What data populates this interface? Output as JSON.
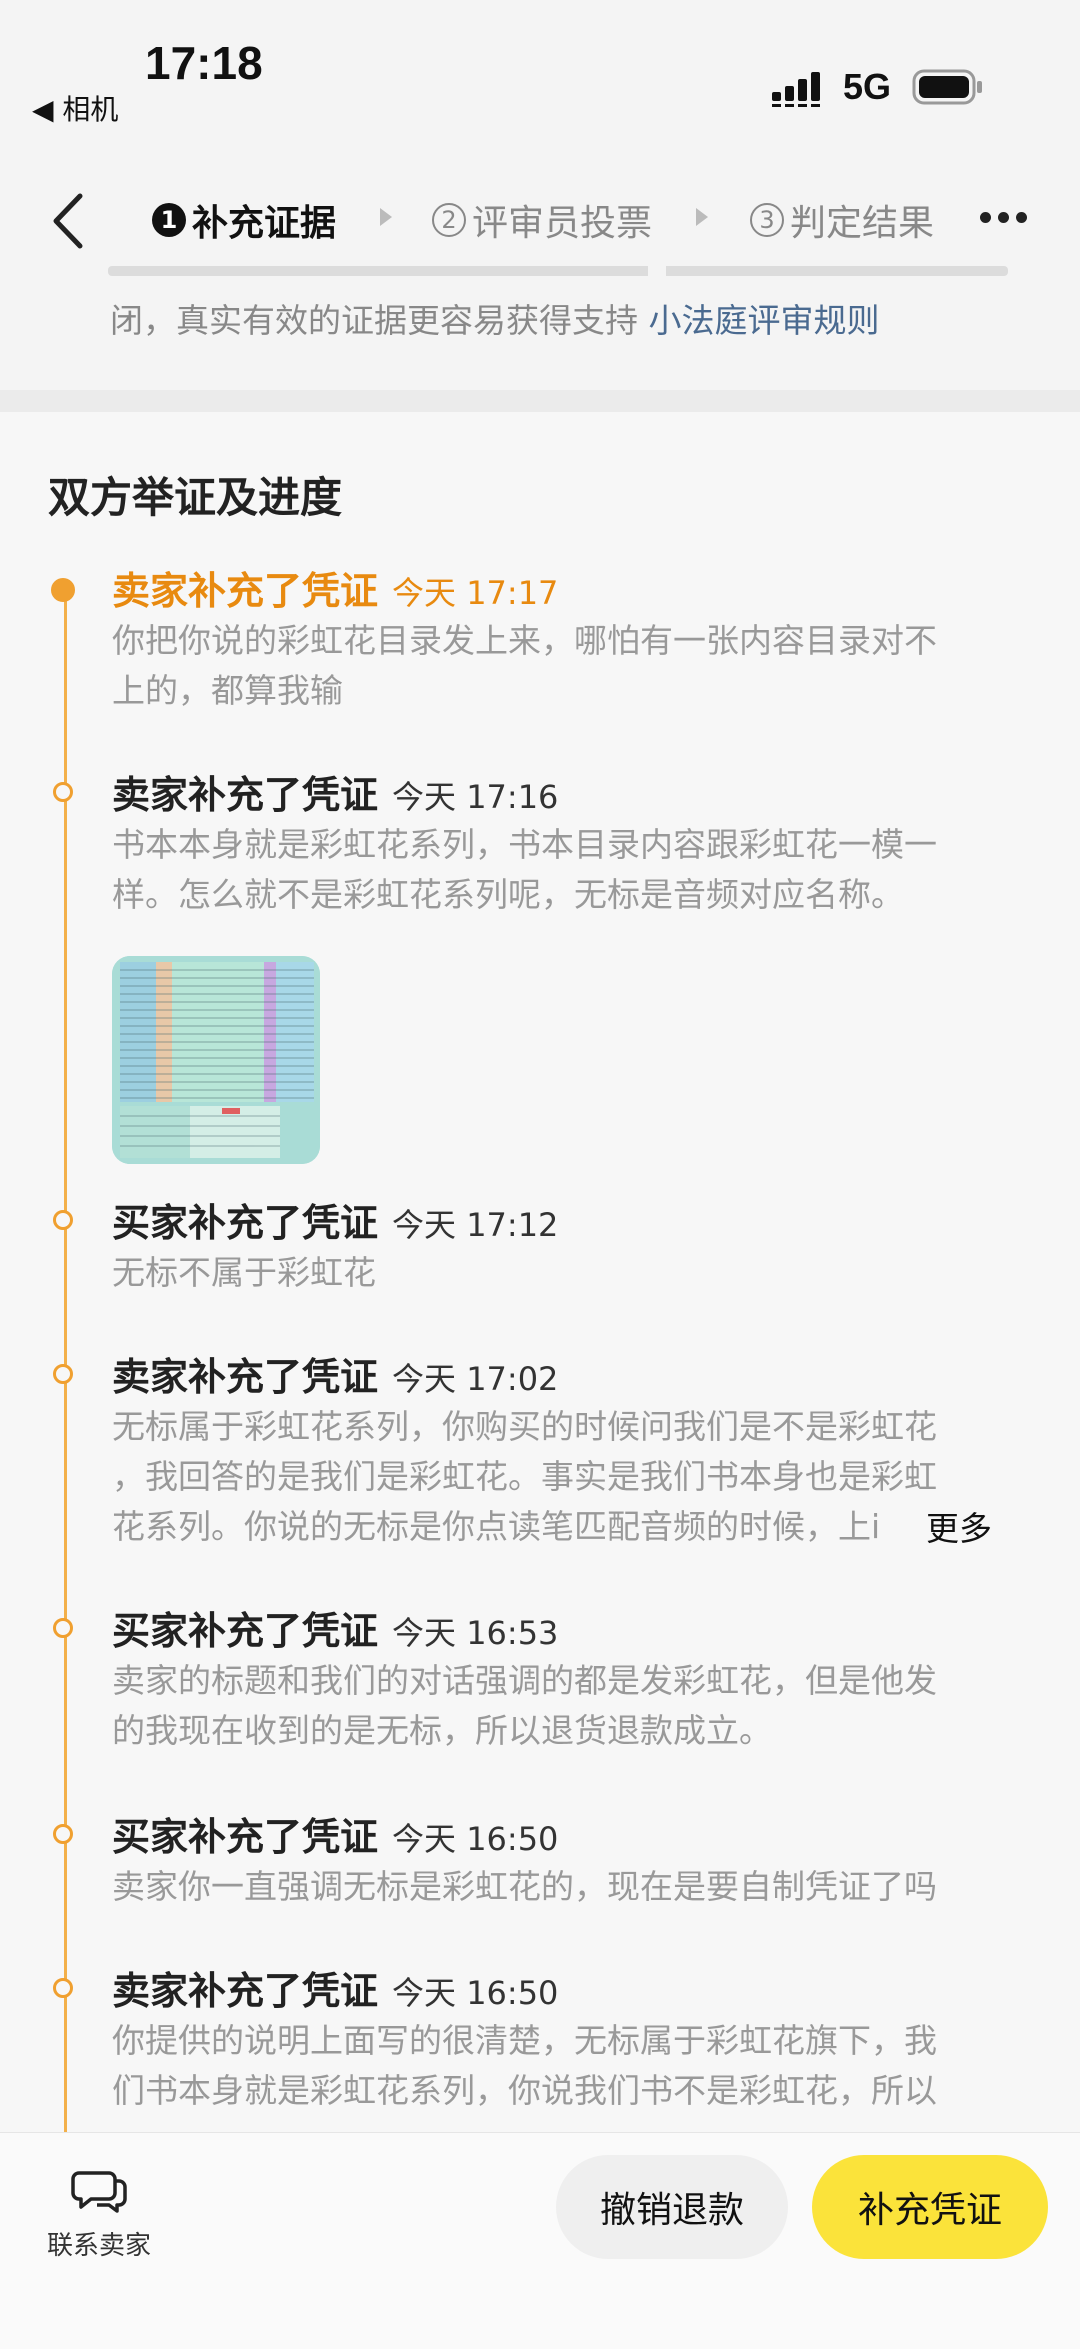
{
  "status_bar": {
    "time": "17:18",
    "back_app": "◀ 相机",
    "network": "5G"
  },
  "nav": {
    "steps": [
      {
        "num": "1",
        "label": "补充证据"
      },
      {
        "num": "2",
        "label": "评审员投票"
      },
      {
        "num": "3",
        "label": "判定结果"
      }
    ]
  },
  "notice": {
    "text": "闭，真实有效的证据更容易获得支持",
    "link": "小法庭评审规则"
  },
  "section": {
    "title": "双方举证及进度"
  },
  "entries": [
    {
      "title": "卖家补充了凭证",
      "time": "今天 17:17",
      "lines": [
        "你把你说的彩虹花目录发上来，哪怕有一张内容目录对不",
        "上的，都算我输"
      ]
    },
    {
      "title": "卖家补充了凭证",
      "time": "今天 17:16",
      "lines": [
        "书本本身就是彩虹花系列，书本目录内容跟彩虹花一模一",
        "样。怎么就不是彩虹花系列呢，无标是音频对应名称。"
      ]
    },
    {
      "title": "买家补充了凭证",
      "time": "今天 17:12",
      "lines": [
        "无标不属于彩虹花"
      ]
    },
    {
      "title": "卖家补充了凭证",
      "time": "今天 17:02",
      "lines": [
        "无标属于彩虹花系列，你购买的时候问我们是不是彩虹花",
        "，我回答的是我们是彩虹花。事实是我们书本身也是彩虹",
        "花系列。你说的无标是你点读笔匹配音频的时候，上i"
      ],
      "more": "更多"
    },
    {
      "title": "买家补充了凭证",
      "time": "今天 16:53",
      "lines": [
        "卖家的标题和我们的对话强调的都是发彩虹花，但是他发",
        "的我现在收到的是无标，所以退货退款成立。"
      ]
    },
    {
      "title": "买家补充了凭证",
      "time": "今天 16:50",
      "lines": [
        "卖家你一直强调无标是彩虹花的，现在是要自制凭证了吗"
      ]
    },
    {
      "title": "卖家补充了凭证",
      "time": "今天 16:50",
      "lines": [
        "你提供的说明上面写的很清楚，无标属于彩虹花旗下，我",
        "们书本身就是彩虹花系列，你说我们书不是彩虹花，所以"
      ]
    }
  ],
  "bottom": {
    "contact_label": "联系卖家",
    "cancel_label": "撤销退款",
    "add_label": "补充凭证"
  },
  "colors": {
    "accent_orange": "#f0a030",
    "button_yellow": "#fbe33a"
  }
}
